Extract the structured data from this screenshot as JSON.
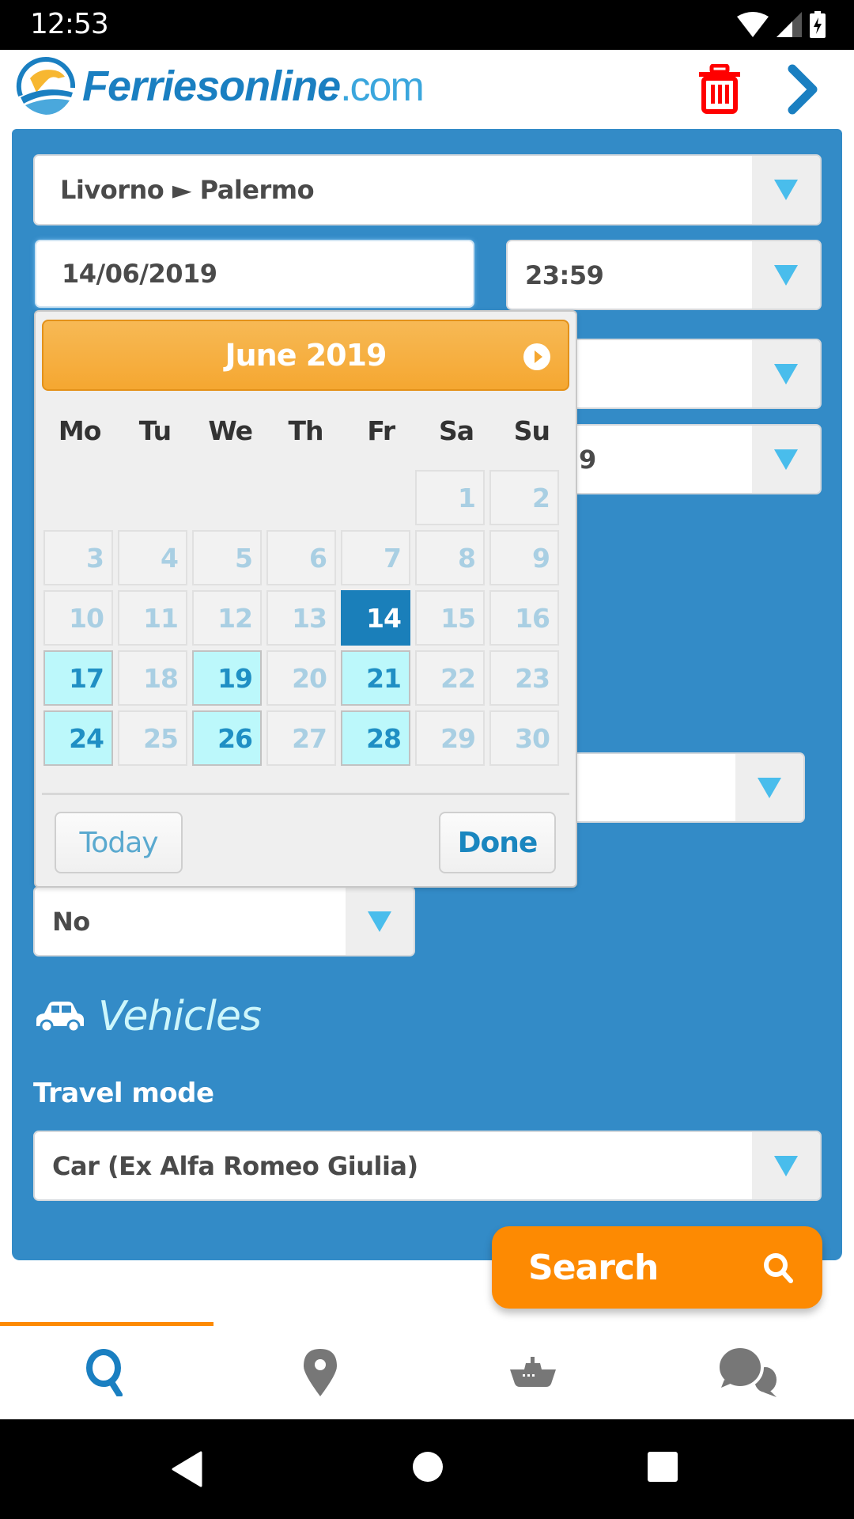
{
  "status_bar": {
    "time": "12:53",
    "icons": [
      "wifi-icon",
      "cell-signal-icon",
      "battery-charging-icon"
    ]
  },
  "header": {
    "logo_main": "Ferriesonline",
    "logo_suffix": ".com",
    "actions": [
      "trash-icon",
      "chevron-right-icon"
    ],
    "colors": {
      "brand_blue": "#1a7fc1",
      "trash_red": "#ff0000"
    }
  },
  "form": {
    "route": {
      "value": "Livorno ► Palermo"
    },
    "date": {
      "value": "14/06/2019"
    },
    "time": {
      "value": "23:59"
    },
    "return_time_partial": {
      "value": "9"
    },
    "pets_select": {
      "value": "No"
    },
    "vehicles": {
      "title": "Vehicles",
      "icon": "car-icon",
      "travel_mode_label": "Travel mode",
      "travel_mode_value": "Car (Ex Alfa Romeo Giulia)"
    },
    "search_button": {
      "label": "Search",
      "icon": "search-icon"
    },
    "panel_color": "#338bc7"
  },
  "datepicker": {
    "month_title": "June 2019",
    "next_icon": "circle-arrow-right-icon",
    "weekdays": [
      "Mo",
      "Tu",
      "We",
      "Th",
      "Fr",
      "Sa",
      "Su"
    ],
    "leading_blanks": 5,
    "days": [
      {
        "d": "1",
        "state": "disabled"
      },
      {
        "d": "2",
        "state": "disabled"
      },
      {
        "d": "3",
        "state": "disabled"
      },
      {
        "d": "4",
        "state": "disabled"
      },
      {
        "d": "5",
        "state": "disabled"
      },
      {
        "d": "6",
        "state": "disabled"
      },
      {
        "d": "7",
        "state": "disabled"
      },
      {
        "d": "8",
        "state": "disabled"
      },
      {
        "d": "9",
        "state": "disabled"
      },
      {
        "d": "10",
        "state": "disabled"
      },
      {
        "d": "11",
        "state": "disabled"
      },
      {
        "d": "12",
        "state": "disabled"
      },
      {
        "d": "13",
        "state": "disabled"
      },
      {
        "d": "14",
        "state": "selected"
      },
      {
        "d": "15",
        "state": "disabled"
      },
      {
        "d": "16",
        "state": "disabled"
      },
      {
        "d": "17",
        "state": "available"
      },
      {
        "d": "18",
        "state": "disabled"
      },
      {
        "d": "19",
        "state": "available"
      },
      {
        "d": "20",
        "state": "disabled"
      },
      {
        "d": "21",
        "state": "available"
      },
      {
        "d": "22",
        "state": "disabled"
      },
      {
        "d": "23",
        "state": "disabled"
      },
      {
        "d": "24",
        "state": "available"
      },
      {
        "d": "25",
        "state": "disabled"
      },
      {
        "d": "26",
        "state": "available"
      },
      {
        "d": "27",
        "state": "disabled"
      },
      {
        "d": "28",
        "state": "available"
      },
      {
        "d": "29",
        "state": "disabled"
      },
      {
        "d": "30",
        "state": "disabled"
      }
    ],
    "today_label": "Today",
    "done_label": "Done",
    "colors": {
      "header": "#f5a731",
      "selected": "#1a7fba",
      "available": "#bcf8fb",
      "disabled_text": "#a9cfe3"
    }
  },
  "bottom_nav": {
    "tabs": [
      {
        "name": "search",
        "icon": "search-icon",
        "active": true
      },
      {
        "name": "ports",
        "icon": "map-pin-icon",
        "active": false
      },
      {
        "name": "ferries",
        "icon": "ship-icon",
        "active": false
      },
      {
        "name": "chat",
        "icon": "chat-bubbles-icon",
        "active": false
      }
    ],
    "active_color": "#1a7fc1",
    "indicator_color": "#fd8a02"
  },
  "system_nav": {
    "buttons": [
      "back-icon",
      "home-icon",
      "recents-icon"
    ]
  }
}
